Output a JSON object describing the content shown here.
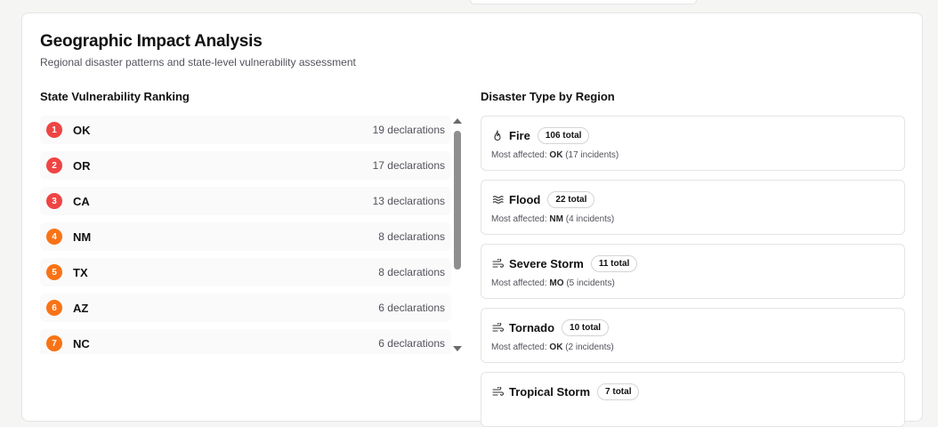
{
  "header": {
    "title": "Geographic Impact Analysis",
    "subtitle": "Regional disaster patterns and state-level vulnerability assessment"
  },
  "ranking": {
    "heading": "State Vulnerability Ranking",
    "rows": [
      {
        "rank": "1",
        "state": "OK",
        "count": "19 declarations",
        "color": "#ef4444"
      },
      {
        "rank": "2",
        "state": "OR",
        "count": "17 declarations",
        "color": "#ef4444"
      },
      {
        "rank": "3",
        "state": "CA",
        "count": "13 declarations",
        "color": "#ef4444"
      },
      {
        "rank": "4",
        "state": "NM",
        "count": "8 declarations",
        "color": "#f97316"
      },
      {
        "rank": "5",
        "state": "TX",
        "count": "8 declarations",
        "color": "#f97316"
      },
      {
        "rank": "6",
        "state": "AZ",
        "count": "6 declarations",
        "color": "#f97316"
      },
      {
        "rank": "7",
        "state": "NC",
        "count": "6 declarations",
        "color": "#f97316"
      }
    ]
  },
  "by_region": {
    "heading": "Disaster Type by Region",
    "most_affected_label": "Most affected:",
    "items": [
      {
        "name": "Fire",
        "icon": "flame-icon",
        "total": "106 total",
        "state": "OK",
        "incidents": "(17 incidents)"
      },
      {
        "name": "Flood",
        "icon": "waves-icon",
        "total": "22 total",
        "state": "NM",
        "incidents": "(4 incidents)"
      },
      {
        "name": "Severe Storm",
        "icon": "wind-icon",
        "total": "11 total",
        "state": "MO",
        "incidents": "(5 incidents)"
      },
      {
        "name": "Tornado",
        "icon": "wind-icon",
        "total": "10 total",
        "state": "OK",
        "incidents": "(2 incidents)"
      },
      {
        "name": "Tropical Storm",
        "icon": "wind-icon",
        "total": "7 total",
        "state": "",
        "incidents": ""
      }
    ]
  }
}
